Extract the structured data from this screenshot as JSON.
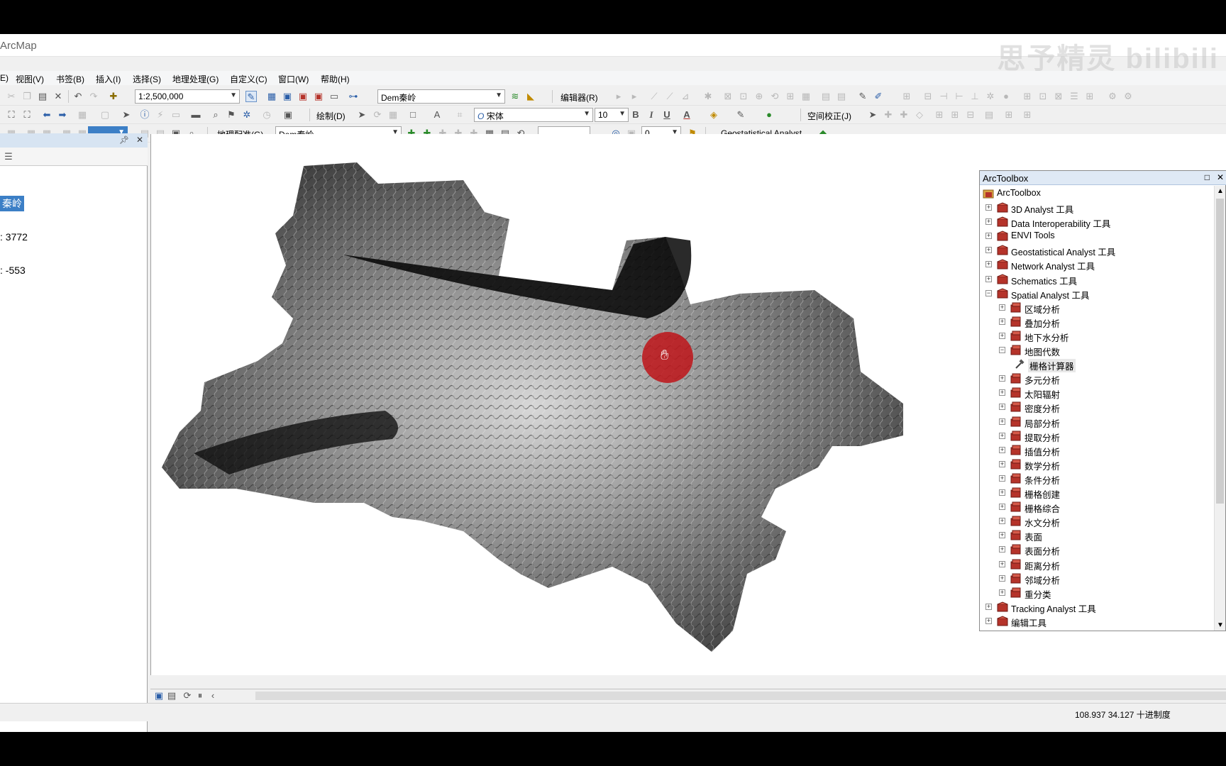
{
  "window": {
    "title": "ArcMap",
    "watermark": "思予精灵 bilibili"
  },
  "menu": [
    "E)",
    "视图(V)",
    "书签(B)",
    "插入(I)",
    "选择(S)",
    "地理处理(G)",
    "自定义(C)",
    "窗口(W)",
    "帮助(H)"
  ],
  "toolbar": {
    "scale": "1:2,500,000",
    "layer_combo": "Dem秦岭",
    "editor_label": "编辑器(R)",
    "draw_label": "绘制(D)",
    "font_combo": "宋体",
    "font_size": "10",
    "bold": "B",
    "italic": "I",
    "underline": "U",
    "spatial_adjust_label": "空间校正(J)",
    "georef_label": "地理配准(G)",
    "georef_layer": "Dem秦岭",
    "number_combo": "0",
    "geostat_label": "Geostatistical Analyst"
  },
  "toc": {
    "layer_name": "秦岭",
    "high_value": ": 3772",
    "low_value": ": -553"
  },
  "toolbox": {
    "title": "ArcToolbox",
    "root": "ArcToolbox",
    "items": [
      {
        "label": "3D Analyst 工具",
        "level": 1,
        "expander": "+",
        "icon": "toolbox-icon"
      },
      {
        "label": "Data Interoperability 工具",
        "level": 1,
        "expander": "+",
        "icon": "toolbox-icon"
      },
      {
        "label": "ENVI Tools",
        "level": 1,
        "expander": "+",
        "icon": "toolbox-icon"
      },
      {
        "label": "Geostatistical Analyst 工具",
        "level": 1,
        "expander": "+",
        "icon": "toolbox-icon"
      },
      {
        "label": "Network Analyst 工具",
        "level": 1,
        "expander": "+",
        "icon": "toolbox-icon"
      },
      {
        "label": "Schematics 工具",
        "level": 1,
        "expander": "+",
        "icon": "toolbox-icon"
      },
      {
        "label": "Spatial Analyst 工具",
        "level": 1,
        "expander": "−",
        "icon": "toolbox-icon"
      },
      {
        "label": "区域分析",
        "level": 2,
        "expander": "+",
        "icon": "toolset-icon"
      },
      {
        "label": "叠加分析",
        "level": 2,
        "expander": "+",
        "icon": "toolset-icon"
      },
      {
        "label": "地下水分析",
        "level": 2,
        "expander": "+",
        "icon": "toolset-icon"
      },
      {
        "label": "地图代数",
        "level": 2,
        "expander": "−",
        "icon": "toolset-icon"
      },
      {
        "label": "栅格计算器",
        "level": 3,
        "expander": "",
        "icon": "hammer-icon",
        "selected": true
      },
      {
        "label": "多元分析",
        "level": 2,
        "expander": "+",
        "icon": "toolset-icon"
      },
      {
        "label": "太阳辐射",
        "level": 2,
        "expander": "+",
        "icon": "toolset-icon"
      },
      {
        "label": "密度分析",
        "level": 2,
        "expander": "+",
        "icon": "toolset-icon"
      },
      {
        "label": "局部分析",
        "level": 2,
        "expander": "+",
        "icon": "toolset-icon"
      },
      {
        "label": "提取分析",
        "level": 2,
        "expander": "+",
        "icon": "toolset-icon"
      },
      {
        "label": "插值分析",
        "level": 2,
        "expander": "+",
        "icon": "toolset-icon"
      },
      {
        "label": "数学分析",
        "level": 2,
        "expander": "+",
        "icon": "toolset-icon"
      },
      {
        "label": "条件分析",
        "level": 2,
        "expander": "+",
        "icon": "toolset-icon"
      },
      {
        "label": "栅格创建",
        "level": 2,
        "expander": "+",
        "icon": "toolset-icon"
      },
      {
        "label": "栅格综合",
        "level": 2,
        "expander": "+",
        "icon": "toolset-icon"
      },
      {
        "label": "水文分析",
        "level": 2,
        "expander": "+",
        "icon": "toolset-icon"
      },
      {
        "label": "表面",
        "level": 2,
        "expander": "+",
        "icon": "toolset-icon"
      },
      {
        "label": "表面分析",
        "level": 2,
        "expander": "+",
        "icon": "toolset-icon"
      },
      {
        "label": "距离分析",
        "level": 2,
        "expander": "+",
        "icon": "toolset-icon"
      },
      {
        "label": "邻域分析",
        "level": 2,
        "expander": "+",
        "icon": "toolset-icon"
      },
      {
        "label": "重分类",
        "level": 2,
        "expander": "+",
        "icon": "toolset-icon"
      },
      {
        "label": "Tracking Analyst 工具",
        "level": 1,
        "expander": "+",
        "icon": "toolbox-icon"
      },
      {
        "label": "编辑工具",
        "level": 1,
        "expander": "+",
        "icon": "toolbox-icon"
      }
    ]
  },
  "status": {
    "coords": "108.937  34.127 十进制度"
  },
  "colors": {
    "toc_selection": "#3c7fc6",
    "cursor_highlight": "#be1419",
    "toolbox_icon": "#b5332a"
  }
}
